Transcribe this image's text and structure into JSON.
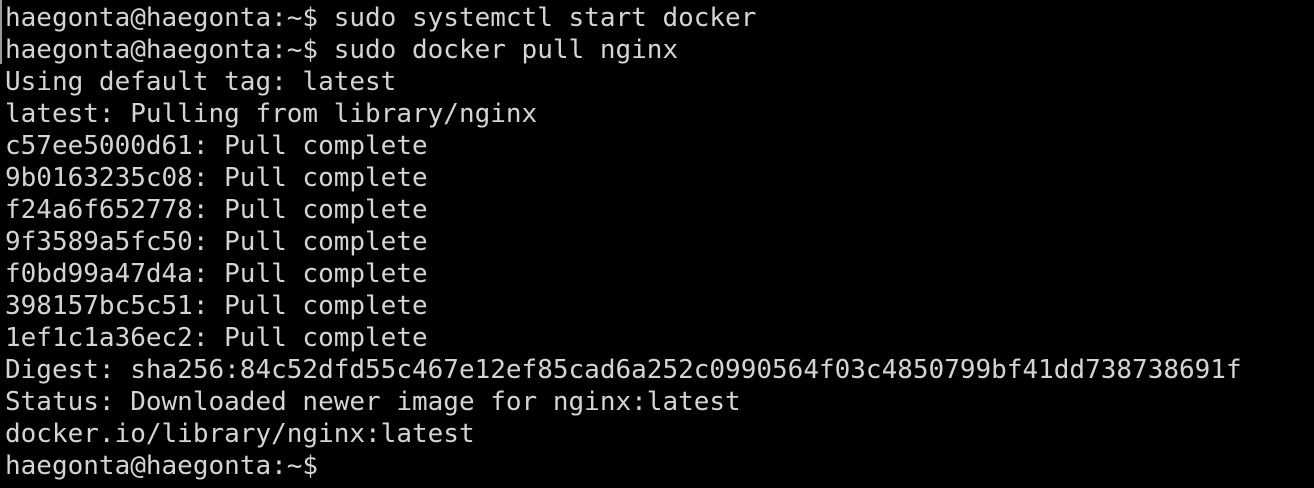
{
  "terminal": {
    "lines": [
      "haegonta@haegonta:~$ sudo systemctl start docker",
      "haegonta@haegonta:~$ sudo docker pull nginx",
      "Using default tag: latest",
      "latest: Pulling from library/nginx",
      "c57ee5000d61: Pull complete",
      "9b0163235c08: Pull complete",
      "f24a6f652778: Pull complete",
      "9f3589a5fc50: Pull complete",
      "f0bd99a47d4a: Pull complete",
      "398157bc5c51: Pull complete",
      "1ef1c1a36ec2: Pull complete",
      "Digest: sha256:84c52dfd55c467e12ef85cad6a252c0990564f03c4850799bf41dd738738691f",
      "Status: Downloaded newer image for nginx:latest",
      "docker.io/library/nginx:latest"
    ],
    "prompt": "haegonta@haegonta:~$ "
  },
  "colors": {
    "background": "#000000",
    "text": "#d4d4d4"
  }
}
